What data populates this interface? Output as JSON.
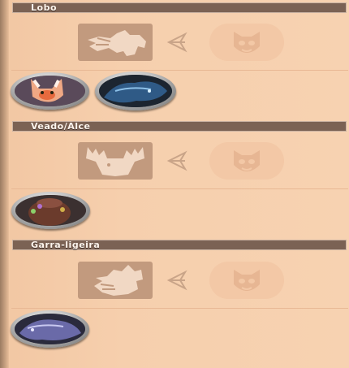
{
  "sections": [
    {
      "title": "Lobo"
    },
    {
      "title": "Veado/Alce"
    },
    {
      "title": "Garra-ligeira"
    }
  ],
  "icons": {
    "lobo": [
      "wolf-head-icon",
      "arrow-left-icon",
      "mask-icon",
      "fox-pet-icon",
      "blue-wolf-mount-icon"
    ],
    "veado": [
      "moose-head-icon",
      "arrow-left-icon",
      "mask-icon",
      "brown-creature-pet-icon"
    ],
    "garra": [
      "raptor-head-icon",
      "arrow-left-icon",
      "mask-icon",
      "purple-raptor-mount-icon"
    ]
  },
  "colors": {
    "background": "#f6cfad",
    "header": "#7b6254",
    "tile": "#c29a7e",
    "tile_ink": "#f1d8c4",
    "mask_fill": "#f3c8a6",
    "mask_ink": "#e7b693"
  }
}
